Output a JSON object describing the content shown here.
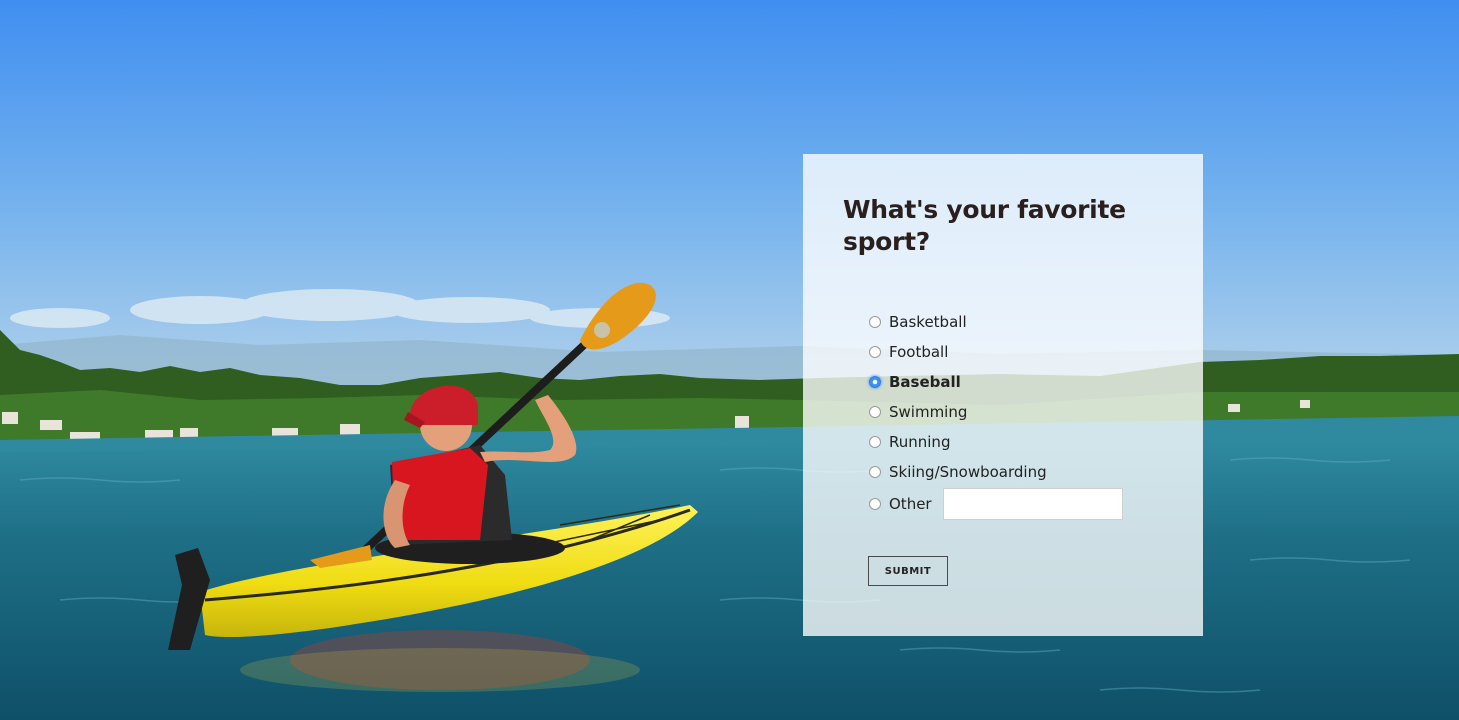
{
  "form": {
    "title": "What's your favorite sport?",
    "options": [
      {
        "label": "Basketball",
        "checked": false
      },
      {
        "label": "Football",
        "checked": false
      },
      {
        "label": "Baseball",
        "checked": true
      },
      {
        "label": "Swimming",
        "checked": false
      },
      {
        "label": "Running",
        "checked": false
      },
      {
        "label": "Skiing/Snowboarding",
        "checked": false
      },
      {
        "label": "Other",
        "checked": false
      }
    ],
    "other_value": "",
    "submit_label": "SUBMIT"
  },
  "colors": {
    "card_background": "#ffffff",
    "title_text": "#2a1f1c",
    "radio_selected": "#3d8ff0",
    "sky": "#7ab7ef",
    "water": "#1f6f85",
    "kayak": "#f2e21a",
    "life_vest": "#d8161f"
  }
}
